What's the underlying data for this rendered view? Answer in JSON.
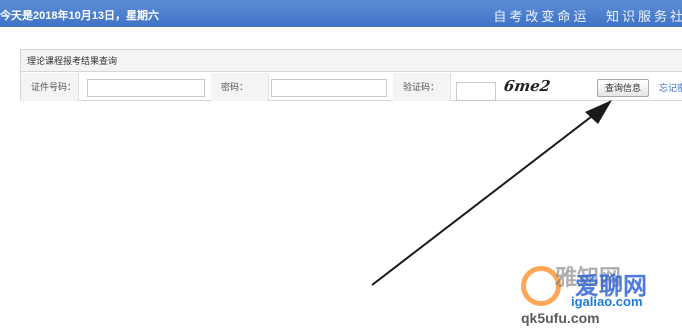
{
  "header": {
    "date_text": "今天是2018年10月13日，星期六",
    "slogan_left": "自考改变命运",
    "slogan_right": "知识服务社"
  },
  "panel": {
    "title": "理论课程报考结果查询",
    "id_label": "证件号码：",
    "id_value": "",
    "password_label": "密码：",
    "password_value": "",
    "captcha_label": "验证码：",
    "captcha_value": "",
    "captcha_text": "6me2",
    "query_button": "查询信息",
    "forgot_link": "忘记密"
  },
  "watermark": {
    "brand": "雅知网",
    "cn_text": "爱聊网",
    "url": "igaliao.com",
    "url2": "qk5ufu.com"
  },
  "colors": {
    "header_bg": "#4a7fcc",
    "link": "#3366cc",
    "arrow": "#1a1a1a"
  }
}
